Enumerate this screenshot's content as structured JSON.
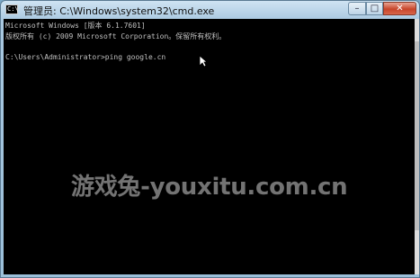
{
  "window": {
    "title": "管理员: C:\\Windows\\system32\\cmd.exe",
    "app_icon_text": "C:\\",
    "controls": {
      "minimize": "–",
      "maximize": "□",
      "close": "✕"
    }
  },
  "console": {
    "lines": [
      "Microsoft Windows [版本 6.1.7601]",
      "版权所有 (c) 2009 Microsoft Corporation。保留所有权利。",
      "",
      "C:\\Users\\Administrator>ping google.cn"
    ]
  },
  "watermark": "游戏兔-youxitu.com.cn",
  "icons": {
    "app": "cmd-icon",
    "pointer": "mouse-pointer-icon"
  }
}
